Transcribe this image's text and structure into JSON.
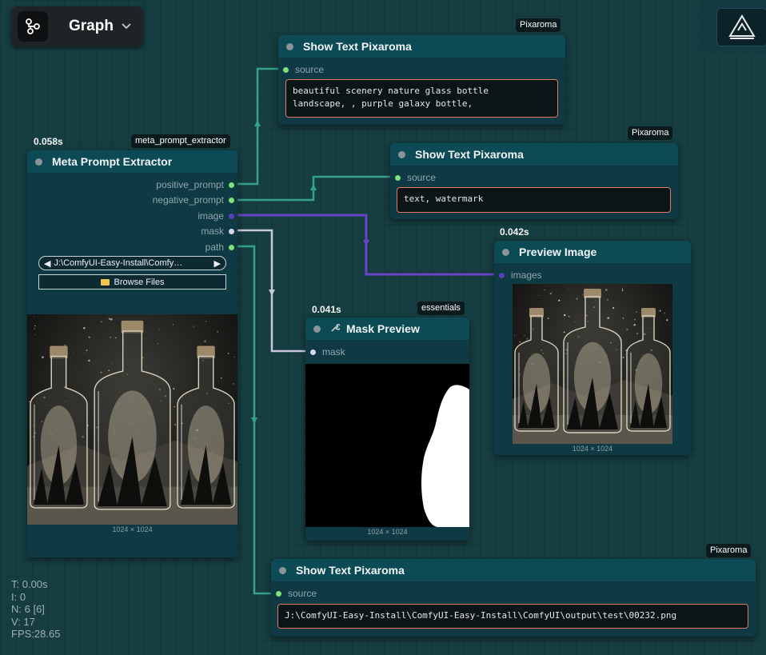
{
  "toolbar": {
    "graph_label": "Graph",
    "graph_icon": "workflow-icon",
    "chevron_icon": "chevron-down-icon",
    "logo_icon": "pixaroma-logo-icon"
  },
  "nodes": {
    "meta": {
      "time": "0.058s",
      "badge": "meta_prompt_extractor",
      "title": "Meta Prompt Extractor",
      "outputs": [
        "positive_prompt",
        "negative_prompt",
        "image",
        "mask",
        "path"
      ],
      "path_value": "J:\\ComfyUI-Easy-Install\\Comfy…",
      "browse_label": "Browse Files",
      "dims": "1024 × 1024"
    },
    "show1": {
      "badge": "Pixaroma",
      "title": "Show Text Pixaroma",
      "input": "source",
      "text": "beautiful scenery nature glass bottle\nlandscape, , purple galaxy bottle,"
    },
    "show2": {
      "badge": "Pixaroma",
      "title": "Show Text Pixaroma",
      "input": "source",
      "text": "text, watermark"
    },
    "preview": {
      "time": "0.042s",
      "title": "Preview Image",
      "input": "images",
      "dims": "1024 × 1024"
    },
    "mask": {
      "time": "0.041s",
      "badge": "essentials",
      "title": "Mask Preview",
      "input": "mask",
      "dims": "1024 × 1024"
    },
    "show3": {
      "badge": "Pixaroma",
      "title": "Show Text Pixaroma",
      "input": "source",
      "text": "J:\\ComfyUI-Easy-Install\\ComfyUI-Easy-Install\\ComfyUI\\output\\test\\00232.png"
    }
  },
  "colors": {
    "string_wire": "#35a18a",
    "image_wire": "#6a44c7",
    "mask_wire": "#c9c6dd",
    "string_dot": "#7ee27a",
    "image_dot": "#5b3fc2",
    "mask_dot": "#d8d6e8"
  },
  "stats": {
    "t": "T: 0.00s",
    "i": "I: 0",
    "n": "N: 6 [6]",
    "v": "V: 17",
    "fps": "FPS:28.65"
  }
}
